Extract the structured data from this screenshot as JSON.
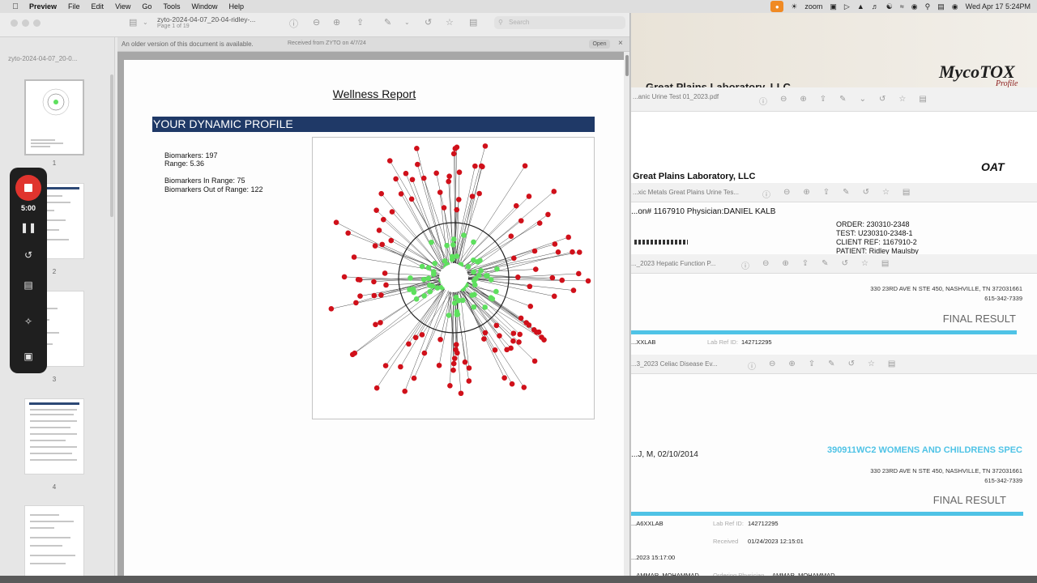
{
  "menubar": {
    "app": "Preview",
    "items": [
      "File",
      "Edit",
      "View",
      "Go",
      "Tools",
      "Window",
      "Help"
    ],
    "zoom_label": "zoom",
    "clock": "Wed Apr 17  5:24PM"
  },
  "window": {
    "title": "zyto-2024-04-07_20-04-ridley-...",
    "subtitle": "Page 1 of 19",
    "search_placeholder": "Search"
  },
  "notice": {
    "message": "An older version of this document is available.",
    "source": "Received from ZYTO on 4/7/24",
    "open_label": "Open"
  },
  "sidebar": {
    "filename": "zyto-2024-04-07_20-0...",
    "pages": [
      "1",
      "2",
      "3",
      "4"
    ]
  },
  "recorder": {
    "time": "5:00"
  },
  "report": {
    "title": "Wellness Report",
    "banner": "YOUR DYNAMIC PROFILE",
    "biomarkers": "Biomarkers: 197",
    "range": "Range: 5.36",
    "in_range": "Biomarkers In Range: 75",
    "out_of_range": "Biomarkers Out of Range: 122",
    "chart": {
      "in_range_count": 75,
      "out_of_range_count": 122,
      "in_color": "#5ee05e",
      "out_color": "#d0101a",
      "line_color": "#222222"
    }
  },
  "bg_windows": {
    "mycotox": {
      "brand": "MycoTOX",
      "brand_sub": "Profile",
      "file": "Great Plains Laboratory, LLC",
      "file2": "...anic Urine Test 01_2023.pdf"
    },
    "oat": {
      "lab": "Great Plains Laboratory, LLC",
      "file": "...xic Metals Great Plains Urine Tes...",
      "physician": "...on# 1167910  Physician:DANIEL KALB",
      "order": "ORDER: 230310-2348",
      "test": "TEST: U230310-2348-1",
      "client": "CLIENT REF: 1167910-2",
      "patient": "PATIENT: Ridley Maulsby",
      "logo": "OAT"
    },
    "hepatic": {
      "file": "..._2023 Hepatic Function P...",
      "address": "330 23RD AVE N STE 450, NASHVILLE, TN 372031661",
      "phone": "615-342-7339",
      "result": "FINAL RESULT",
      "lab_code": "...XXLAB",
      "lab_ref_label": "Lab Ref ID:",
      "lab_ref": "142712295"
    },
    "celiac": {
      "file": "...3_2023 Celiac Disease Ev...",
      "patient": "...J, M, 02/10/2014",
      "facility": "390911WC2 WOMENS AND CHILDRENS SPEC",
      "address": "330 23RD AVE N STE 450, NASHVILLE, TN 372031661",
      "phone": "615-342-7339",
      "result": "FINAL RESULT",
      "lab_code": "...A6XXLAB",
      "lab_ref_label": "Lab Ref ID:",
      "lab_ref": "142712295",
      "received_label": "Received",
      "received": "01/24/2023 12:15:01",
      "collected": "...2023 15:17:00",
      "doctor": "...AMMAR, MOHAMMAD",
      "ordering_label": "Ordering Physician",
      "ordering": "AMMAR, MOHAMMAD"
    }
  }
}
